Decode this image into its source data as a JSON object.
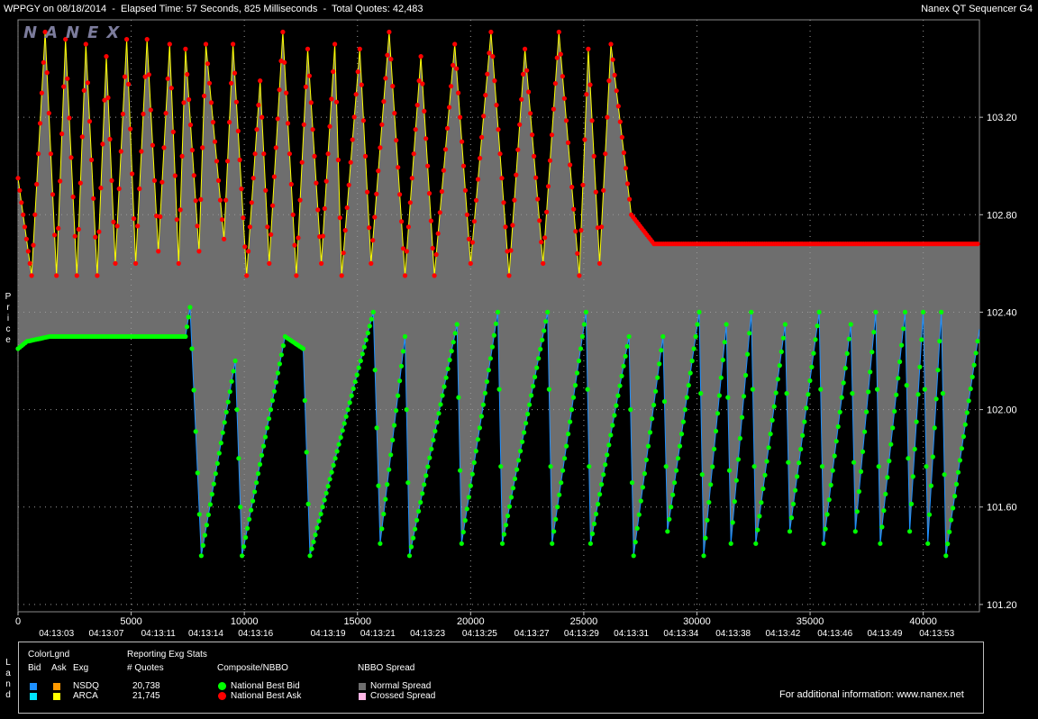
{
  "header": {
    "symbol": "WPPGY",
    "date_text": "on 08/18/2014",
    "elapsed": "Elapsed Time: 57 Seconds, 825 Milliseconds",
    "total_quotes": "Total Quotes: 42,483",
    "left_text": "WPPGY on 08/18/2014  -  Elapsed Time: 57 Seconds, 825 Milliseconds  -  Total Quotes: 42,483",
    "app_name": "Nanex QT Sequencer G4",
    "logo": "NANEX"
  },
  "side_labels": {
    "price": "Price",
    "land": "Land"
  },
  "colors": {
    "bid": "#00ff00",
    "ask": "#ff0000",
    "spread": "#6e6e6e",
    "nsdq_bid": "#1e90ff",
    "nsdq_ask": "#ff9900",
    "arca_bid": "#00e5ff",
    "arca_ask": "#ffff00",
    "crossed": "#ffb6e6"
  },
  "chart_data": {
    "type": "line",
    "xlabel": "",
    "ylabel": "Price",
    "xlim": [
      0,
      42483
    ],
    "ylim": [
      101.17,
      103.6
    ],
    "y_ticks": [
      101.2,
      101.6,
      102.0,
      102.4,
      102.8,
      103.2
    ],
    "y_tick_labels": [
      "101.20",
      "101.60",
      "102.00",
      "102.40",
      "102.80",
      "103.20"
    ],
    "x_ticks": [
      0,
      5000,
      10000,
      15000,
      20000,
      25000,
      30000,
      35000,
      40000
    ],
    "x_tick_labels": [
      "0",
      "5000",
      "10000",
      "15000",
      "20000",
      "25000",
      "30000",
      "35000",
      "40000"
    ],
    "time_ticks": [
      {
        "x": 1700,
        "label": "04:13:03"
      },
      {
        "x": 3900,
        "label": "04:13:07"
      },
      {
        "x": 6200,
        "label": "04:13:11"
      },
      {
        "x": 8300,
        "label": "04:13:14"
      },
      {
        "x": 10500,
        "label": "04:13:16"
      },
      {
        "x": 13700,
        "label": "04:13:19"
      },
      {
        "x": 15900,
        "label": "04:13:21"
      },
      {
        "x": 18100,
        "label": "04:13:23"
      },
      {
        "x": 20400,
        "label": "04:13:25"
      },
      {
        "x": 22700,
        "label": "04:13:27"
      },
      {
        "x": 24900,
        "label": "04:13:29"
      },
      {
        "x": 27100,
        "label": "04:13:31"
      },
      {
        "x": 29300,
        "label": "04:13:34"
      },
      {
        "x": 31600,
        "label": "04:13:38"
      },
      {
        "x": 33800,
        "label": "04:13:42"
      },
      {
        "x": 36100,
        "label": "04:13:46"
      },
      {
        "x": 38300,
        "label": "04:13:49"
      },
      {
        "x": 40600,
        "label": "04:13:53"
      }
    ],
    "grid": true,
    "series": [
      {
        "name": "National Best Ask",
        "color": "#ff0000",
        "x": [
          0,
          600,
          1200,
          1700,
          2100,
          2600,
          3000,
          3500,
          3900,
          4300,
          4800,
          5200,
          5700,
          6200,
          6700,
          7100,
          7400,
          8000,
          8300,
          9100,
          9500,
          10100,
          10700,
          11100,
          11700,
          12300,
          12800,
          13400,
          14000,
          14300,
          15100,
          15600,
          16400,
          17100,
          17800,
          18400,
          19300,
          20000,
          20900,
          21700,
          22400,
          23200,
          23900,
          24800,
          25200,
          25700,
          26200,
          27100,
          28100,
          28600,
          42483
        ],
        "values": [
          102.95,
          102.55,
          103.55,
          102.55,
          103.52,
          102.55,
          103.5,
          102.55,
          103.45,
          102.6,
          103.52,
          102.6,
          103.52,
          102.65,
          103.5,
          102.6,
          103.48,
          102.65,
          103.5,
          102.7,
          103.5,
          102.55,
          103.35,
          102.6,
          103.55,
          102.55,
          103.48,
          102.6,
          103.5,
          102.55,
          103.48,
          102.6,
          103.55,
          102.55,
          103.45,
          102.55,
          103.5,
          102.6,
          103.55,
          102.55,
          103.48,
          102.6,
          103.55,
          102.55,
          103.48,
          102.6,
          103.5,
          102.8,
          102.68,
          102.68,
          102.68
        ]
      },
      {
        "name": "National Best Bid",
        "color": "#00ff00",
        "x": [
          0,
          400,
          1400,
          7400,
          7600,
          8100,
          9600,
          9900,
          11800,
          12600,
          12900,
          15700,
          16000,
          17100,
          17300,
          19400,
          19600,
          21200,
          21400,
          23400,
          23600,
          25100,
          25300,
          27000,
          27200,
          28500,
          28700,
          30100,
          30300,
          31300,
          31500,
          32400,
          32600,
          33900,
          34100,
          35400,
          35600,
          36800,
          37000,
          37900,
          38100,
          39200,
          39400,
          40000,
          40200,
          40800,
          41000,
          42483
        ],
        "values": [
          102.25,
          102.28,
          102.3,
          102.3,
          102.42,
          101.4,
          102.2,
          101.4,
          102.3,
          102.25,
          101.4,
          102.4,
          101.45,
          102.3,
          101.4,
          102.35,
          101.45,
          102.4,
          101.45,
          102.4,
          101.45,
          102.4,
          101.45,
          102.3,
          101.4,
          102.3,
          101.5,
          102.4,
          101.4,
          102.35,
          101.45,
          102.4,
          101.45,
          102.35,
          101.5,
          102.4,
          101.45,
          102.35,
          101.5,
          102.4,
          101.45,
          102.4,
          101.5,
          102.4,
          101.45,
          102.4,
          101.4,
          102.33
        ]
      }
    ]
  },
  "legend": {
    "colorlgnd": "ColorLgnd",
    "bid": "Bid",
    "ask": "Ask",
    "exg": "Exg",
    "reporting": "Reporting Exg Stats",
    "quotes_header": "# Quotes",
    "rows": [
      {
        "exg": "NSDQ",
        "quotes": "20,738",
        "bid_color": "#1e90ff",
        "ask_color": "#ff9900"
      },
      {
        "exg": "ARCA",
        "quotes": "21,745",
        "bid_color": "#00e5ff",
        "ask_color": "#ffff00"
      }
    ],
    "composite_header": "Composite/NBBO",
    "composite": [
      "National Best Bid",
      "National Best Ask"
    ],
    "spread_header": "NBBO Spread",
    "spread": [
      "Normal Spread",
      "Crossed Spread"
    ],
    "info": "For additional information: www.nanex.net"
  }
}
